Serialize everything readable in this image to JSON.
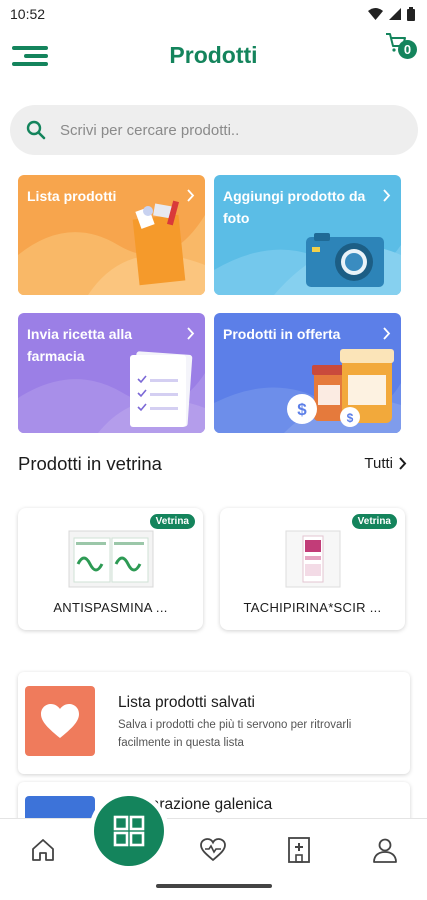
{
  "status_bar": {
    "time": "10:52"
  },
  "header": {
    "title": "Prodotti",
    "cart_count": "0"
  },
  "search": {
    "placeholder": "Scrivi per cercare prodotti.."
  },
  "tiles": [
    {
      "label": "Lista prodotti",
      "color": "#f7a54d",
      "icon": "shopping-bag-icon"
    },
    {
      "label": "Aggiungi prodotto da foto",
      "color": "#5bbde6",
      "icon": "camera-icon"
    },
    {
      "label": "Invia ricetta alla farmacia",
      "color": "#9b7fe6",
      "icon": "prescription-icon"
    },
    {
      "label": "Prodotti in offerta",
      "color": "#5c7fe8",
      "icon": "offer-icon"
    }
  ],
  "showcase": {
    "title": "Prodotti in vetrina",
    "link_label": "Tutti",
    "products": [
      {
        "badge": "Vetrina",
        "name": "ANTISPASMINA ..."
      },
      {
        "badge": "Vetrina",
        "name": "TACHIPIRINA*SCIR ..."
      }
    ]
  },
  "saved_list": {
    "title": "Lista prodotti salvati",
    "description": "Salva i prodotti che più ti servono per ritrovarli facilmente in questa lista",
    "icon": "heart-icon",
    "color": "#ef7b5c"
  },
  "galenic": {
    "title": "Preparazione galenica",
    "color": "#3d73d9",
    "icon": "pen-icon"
  },
  "bottom_nav": [
    {
      "name": "home",
      "icon": "home-icon"
    },
    {
      "name": "catalog",
      "icon": "grid-icon"
    },
    {
      "name": "health",
      "icon": "heart-pulse-icon"
    },
    {
      "name": "pharmacy",
      "icon": "pharmacy-icon"
    },
    {
      "name": "profile",
      "icon": "user-icon"
    }
  ],
  "colors": {
    "primary": "#14845c",
    "search_bg": "#eeeeee"
  }
}
